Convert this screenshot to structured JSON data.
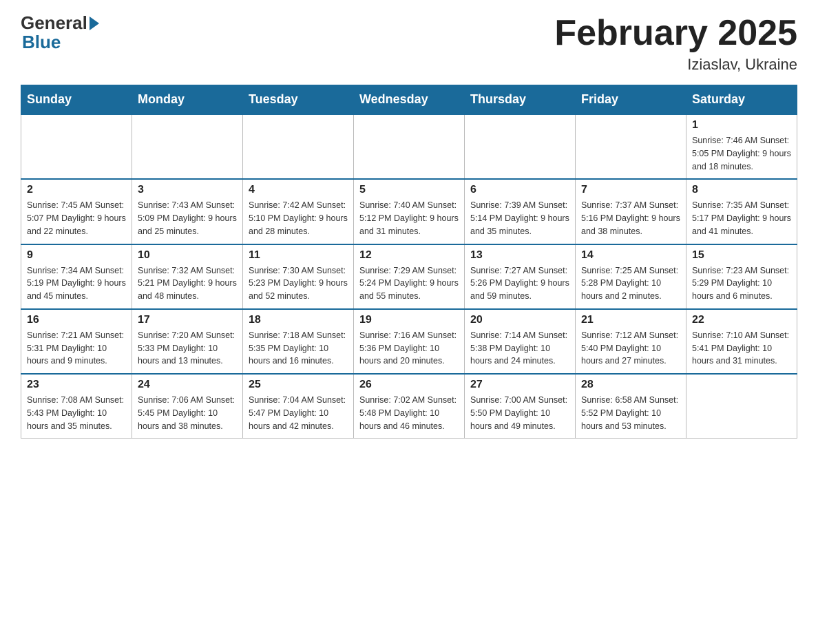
{
  "logo": {
    "general": "General",
    "blue": "Blue"
  },
  "title": "February 2025",
  "subtitle": "Iziaslav, Ukraine",
  "days_of_week": [
    "Sunday",
    "Monday",
    "Tuesday",
    "Wednesday",
    "Thursday",
    "Friday",
    "Saturday"
  ],
  "weeks": [
    [
      {
        "day": "",
        "info": "",
        "empty": true
      },
      {
        "day": "",
        "info": "",
        "empty": true
      },
      {
        "day": "",
        "info": "",
        "empty": true
      },
      {
        "day": "",
        "info": "",
        "empty": true
      },
      {
        "day": "",
        "info": "",
        "empty": true
      },
      {
        "day": "",
        "info": "",
        "empty": true
      },
      {
        "day": "1",
        "info": "Sunrise: 7:46 AM\nSunset: 5:05 PM\nDaylight: 9 hours and 18 minutes.",
        "empty": false
      }
    ],
    [
      {
        "day": "2",
        "info": "Sunrise: 7:45 AM\nSunset: 5:07 PM\nDaylight: 9 hours and 22 minutes.",
        "empty": false
      },
      {
        "day": "3",
        "info": "Sunrise: 7:43 AM\nSunset: 5:09 PM\nDaylight: 9 hours and 25 minutes.",
        "empty": false
      },
      {
        "day": "4",
        "info": "Sunrise: 7:42 AM\nSunset: 5:10 PM\nDaylight: 9 hours and 28 minutes.",
        "empty": false
      },
      {
        "day": "5",
        "info": "Sunrise: 7:40 AM\nSunset: 5:12 PM\nDaylight: 9 hours and 31 minutes.",
        "empty": false
      },
      {
        "day": "6",
        "info": "Sunrise: 7:39 AM\nSunset: 5:14 PM\nDaylight: 9 hours and 35 minutes.",
        "empty": false
      },
      {
        "day": "7",
        "info": "Sunrise: 7:37 AM\nSunset: 5:16 PM\nDaylight: 9 hours and 38 minutes.",
        "empty": false
      },
      {
        "day": "8",
        "info": "Sunrise: 7:35 AM\nSunset: 5:17 PM\nDaylight: 9 hours and 41 minutes.",
        "empty": false
      }
    ],
    [
      {
        "day": "9",
        "info": "Sunrise: 7:34 AM\nSunset: 5:19 PM\nDaylight: 9 hours and 45 minutes.",
        "empty": false
      },
      {
        "day": "10",
        "info": "Sunrise: 7:32 AM\nSunset: 5:21 PM\nDaylight: 9 hours and 48 minutes.",
        "empty": false
      },
      {
        "day": "11",
        "info": "Sunrise: 7:30 AM\nSunset: 5:23 PM\nDaylight: 9 hours and 52 minutes.",
        "empty": false
      },
      {
        "day": "12",
        "info": "Sunrise: 7:29 AM\nSunset: 5:24 PM\nDaylight: 9 hours and 55 minutes.",
        "empty": false
      },
      {
        "day": "13",
        "info": "Sunrise: 7:27 AM\nSunset: 5:26 PM\nDaylight: 9 hours and 59 minutes.",
        "empty": false
      },
      {
        "day": "14",
        "info": "Sunrise: 7:25 AM\nSunset: 5:28 PM\nDaylight: 10 hours and 2 minutes.",
        "empty": false
      },
      {
        "day": "15",
        "info": "Sunrise: 7:23 AM\nSunset: 5:29 PM\nDaylight: 10 hours and 6 minutes.",
        "empty": false
      }
    ],
    [
      {
        "day": "16",
        "info": "Sunrise: 7:21 AM\nSunset: 5:31 PM\nDaylight: 10 hours and 9 minutes.",
        "empty": false
      },
      {
        "day": "17",
        "info": "Sunrise: 7:20 AM\nSunset: 5:33 PM\nDaylight: 10 hours and 13 minutes.",
        "empty": false
      },
      {
        "day": "18",
        "info": "Sunrise: 7:18 AM\nSunset: 5:35 PM\nDaylight: 10 hours and 16 minutes.",
        "empty": false
      },
      {
        "day": "19",
        "info": "Sunrise: 7:16 AM\nSunset: 5:36 PM\nDaylight: 10 hours and 20 minutes.",
        "empty": false
      },
      {
        "day": "20",
        "info": "Sunrise: 7:14 AM\nSunset: 5:38 PM\nDaylight: 10 hours and 24 minutes.",
        "empty": false
      },
      {
        "day": "21",
        "info": "Sunrise: 7:12 AM\nSunset: 5:40 PM\nDaylight: 10 hours and 27 minutes.",
        "empty": false
      },
      {
        "day": "22",
        "info": "Sunrise: 7:10 AM\nSunset: 5:41 PM\nDaylight: 10 hours and 31 minutes.",
        "empty": false
      }
    ],
    [
      {
        "day": "23",
        "info": "Sunrise: 7:08 AM\nSunset: 5:43 PM\nDaylight: 10 hours and 35 minutes.",
        "empty": false
      },
      {
        "day": "24",
        "info": "Sunrise: 7:06 AM\nSunset: 5:45 PM\nDaylight: 10 hours and 38 minutes.",
        "empty": false
      },
      {
        "day": "25",
        "info": "Sunrise: 7:04 AM\nSunset: 5:47 PM\nDaylight: 10 hours and 42 minutes.",
        "empty": false
      },
      {
        "day": "26",
        "info": "Sunrise: 7:02 AM\nSunset: 5:48 PM\nDaylight: 10 hours and 46 minutes.",
        "empty": false
      },
      {
        "day": "27",
        "info": "Sunrise: 7:00 AM\nSunset: 5:50 PM\nDaylight: 10 hours and 49 minutes.",
        "empty": false
      },
      {
        "day": "28",
        "info": "Sunrise: 6:58 AM\nSunset: 5:52 PM\nDaylight: 10 hours and 53 minutes.",
        "empty": false
      },
      {
        "day": "",
        "info": "",
        "empty": true
      }
    ]
  ]
}
